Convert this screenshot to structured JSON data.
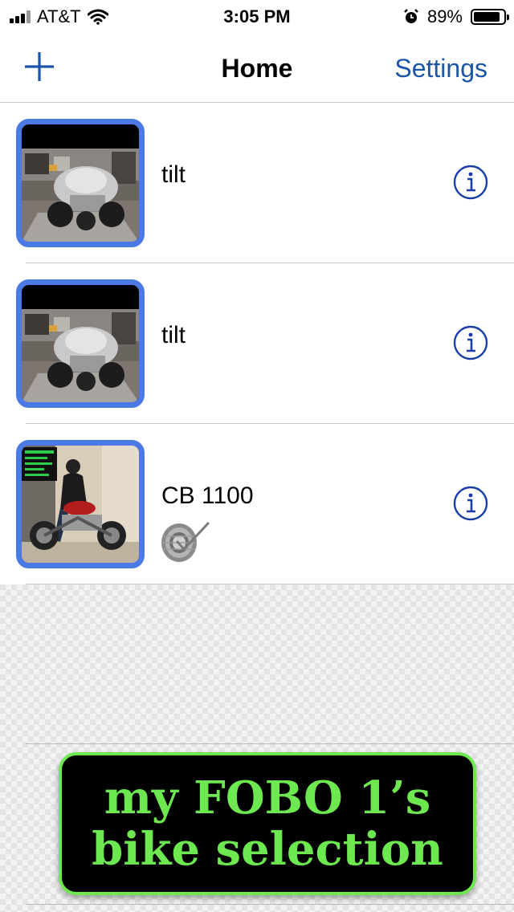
{
  "status_bar": {
    "carrier": "AT&T",
    "time": "3:05 PM",
    "battery_percent": "89%",
    "battery_level": 0.89,
    "icons": [
      "signal-icon",
      "wifi-icon",
      "alarm-icon",
      "battery-icon"
    ]
  },
  "nav": {
    "add_icon": "plus-icon",
    "title": "Home",
    "settings_label": "Settings"
  },
  "bikes": [
    {
      "name": "tilt",
      "photo": "trike-in-garage"
    },
    {
      "name": "tilt",
      "photo": "trike-in-garage"
    },
    {
      "name": "CB 1100",
      "photo": "rider-on-motorcycle",
      "badge_icon": "tire-check-icon"
    }
  ],
  "caption": {
    "line1": "my FOBO 1’s",
    "line2": "bike selection"
  },
  "colors": {
    "accent": "#1a55a8",
    "thumb_border": "#4b79e6",
    "caption_text": "#6ee850",
    "caption_bg": "#000000"
  }
}
